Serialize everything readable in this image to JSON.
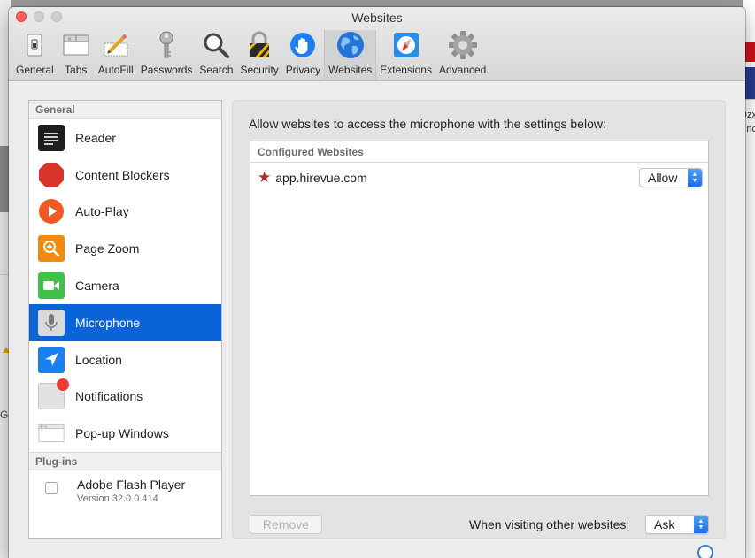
{
  "window": {
    "title": "Websites"
  },
  "toolbar": {
    "items": [
      {
        "label": "General",
        "icon": "general-icon"
      },
      {
        "label": "Tabs",
        "icon": "tabs-icon"
      },
      {
        "label": "AutoFill",
        "icon": "autofill-icon"
      },
      {
        "label": "Passwords",
        "icon": "key-icon"
      },
      {
        "label": "Search",
        "icon": "magnifier-icon"
      },
      {
        "label": "Security",
        "icon": "padlock-icon"
      },
      {
        "label": "Privacy",
        "icon": "hand-icon"
      },
      {
        "label": "Websites",
        "icon": "globe-icon",
        "selected": true
      },
      {
        "label": "Extensions",
        "icon": "puzzle-compass-icon"
      },
      {
        "label": "Advanced",
        "icon": "gear-icon"
      }
    ]
  },
  "sidebar": {
    "general_header": "General",
    "items": [
      {
        "label": "Reader",
        "icon": "reader-icon"
      },
      {
        "label": "Content Blockers",
        "icon": "stop-icon"
      },
      {
        "label": "Auto-Play",
        "icon": "play-icon"
      },
      {
        "label": "Page Zoom",
        "icon": "zoom-icon"
      },
      {
        "label": "Camera",
        "icon": "camera-icon"
      },
      {
        "label": "Microphone",
        "icon": "microphone-icon",
        "selected": true
      },
      {
        "label": "Location",
        "icon": "location-arrow-icon"
      },
      {
        "label": "Notifications",
        "icon": "notification-badge-icon"
      },
      {
        "label": "Pop-up Windows",
        "icon": "popup-window-icon"
      }
    ],
    "plugins_header": "Plug-ins",
    "plugins": [
      {
        "name": "Adobe Flash Player",
        "version": "Version 32.0.0.414",
        "checked": false
      }
    ]
  },
  "panel": {
    "description": "Allow websites to access the microphone with the settings below:",
    "table_header": "Configured Websites",
    "sites": [
      {
        "name": "app.hirevue.com",
        "setting": "Allow"
      }
    ],
    "remove_label": "Remove",
    "other_label": "When visiting other websites:",
    "other_value": "Ask"
  },
  "background": {
    "left_text": "Go",
    "right_text_1": "Dzx",
    "right_text_2": "nc"
  },
  "colors": {
    "selection_blue": "#0a64d8",
    "close_red": "#fc605b",
    "popup_blue": "#1a6ff0",
    "star_red": "#b02a2a"
  }
}
